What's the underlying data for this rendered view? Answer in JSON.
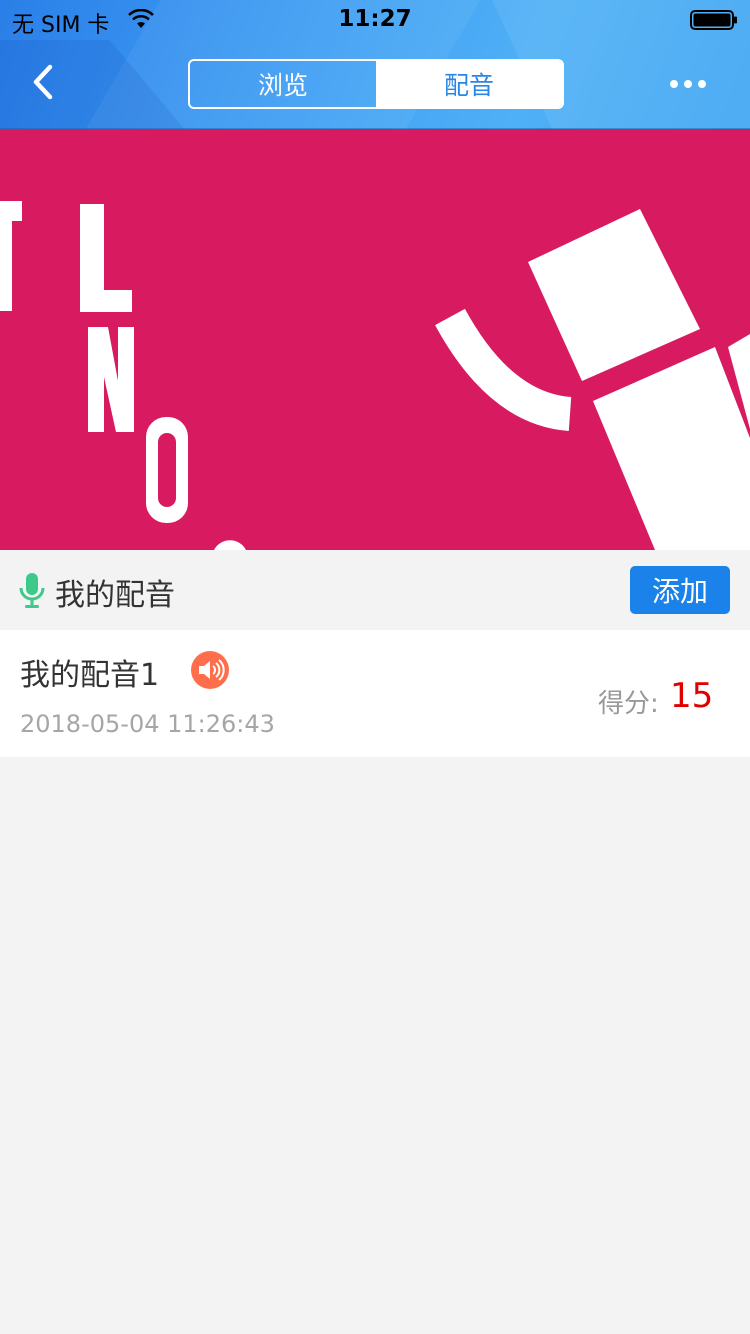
{
  "status_bar": {
    "carrier": "无 SIM 卡",
    "time": "11:27"
  },
  "nav": {
    "tabs": [
      {
        "label": "浏览",
        "active": false
      },
      {
        "label": "配音",
        "active": true
      }
    ]
  },
  "section": {
    "title": "我的配音",
    "add_label": "添加"
  },
  "recordings": [
    {
      "title": "我的配音1",
      "timestamp": "2018-05-04 11:26:43",
      "score_label": "得分:",
      "score": "15"
    }
  ],
  "colors": {
    "header_blue": "#3d9bf3",
    "banner_pink": "#d81b60",
    "add_button": "#1a82e8",
    "score": "#e00000",
    "mic": "#3ec98a",
    "speaker": "#ff6e4a"
  },
  "icons": [
    "back-icon",
    "more-icon",
    "wifi-icon",
    "battery-icon",
    "microphone-icon",
    "speaker-icon"
  ]
}
